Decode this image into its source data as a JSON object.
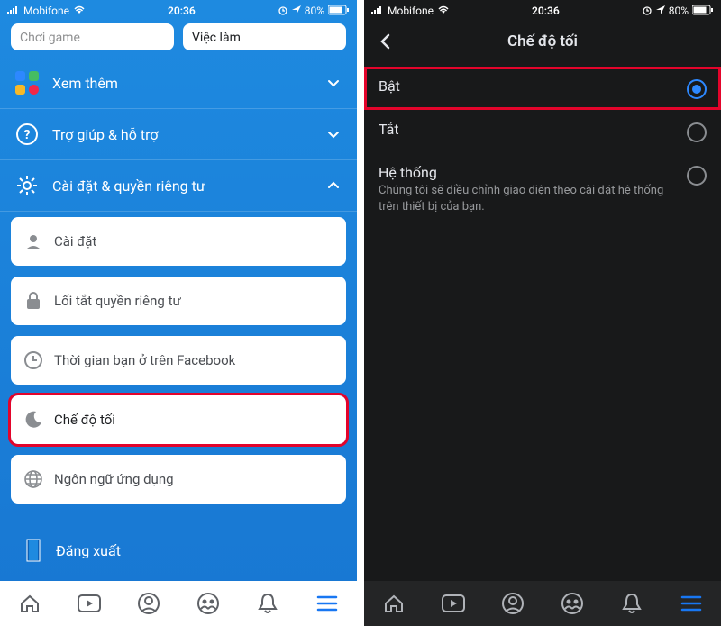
{
  "statusbar": {
    "carrier": "Mobifone",
    "time": "20:36",
    "battery": "80%"
  },
  "left": {
    "topcards": {
      "game": "Chơi game",
      "jobs": "Việc làm"
    },
    "sections": {
      "see_more": "Xem thêm",
      "help": "Trợ giúp & hỗ trợ",
      "settings_privacy": "Cài đặt & quyền riêng tư"
    },
    "options": {
      "settings": "Cài đặt",
      "privacy_shortcut": "Lối tắt quyền riêng tư",
      "time_on_fb": "Thời gian bạn ở trên Facebook",
      "dark_mode": "Chế độ tối",
      "language": "Ngôn ngữ ứng dụng"
    },
    "logout": "Đăng xuất"
  },
  "right": {
    "title": "Chế độ tối",
    "options": {
      "on": "Bật",
      "off": "Tắt",
      "system_label": "Hệ thống",
      "system_desc": "Chúng tôi sẽ điều chỉnh giao diện theo cài đặt hệ thống trên thiết bị của bạn."
    }
  }
}
